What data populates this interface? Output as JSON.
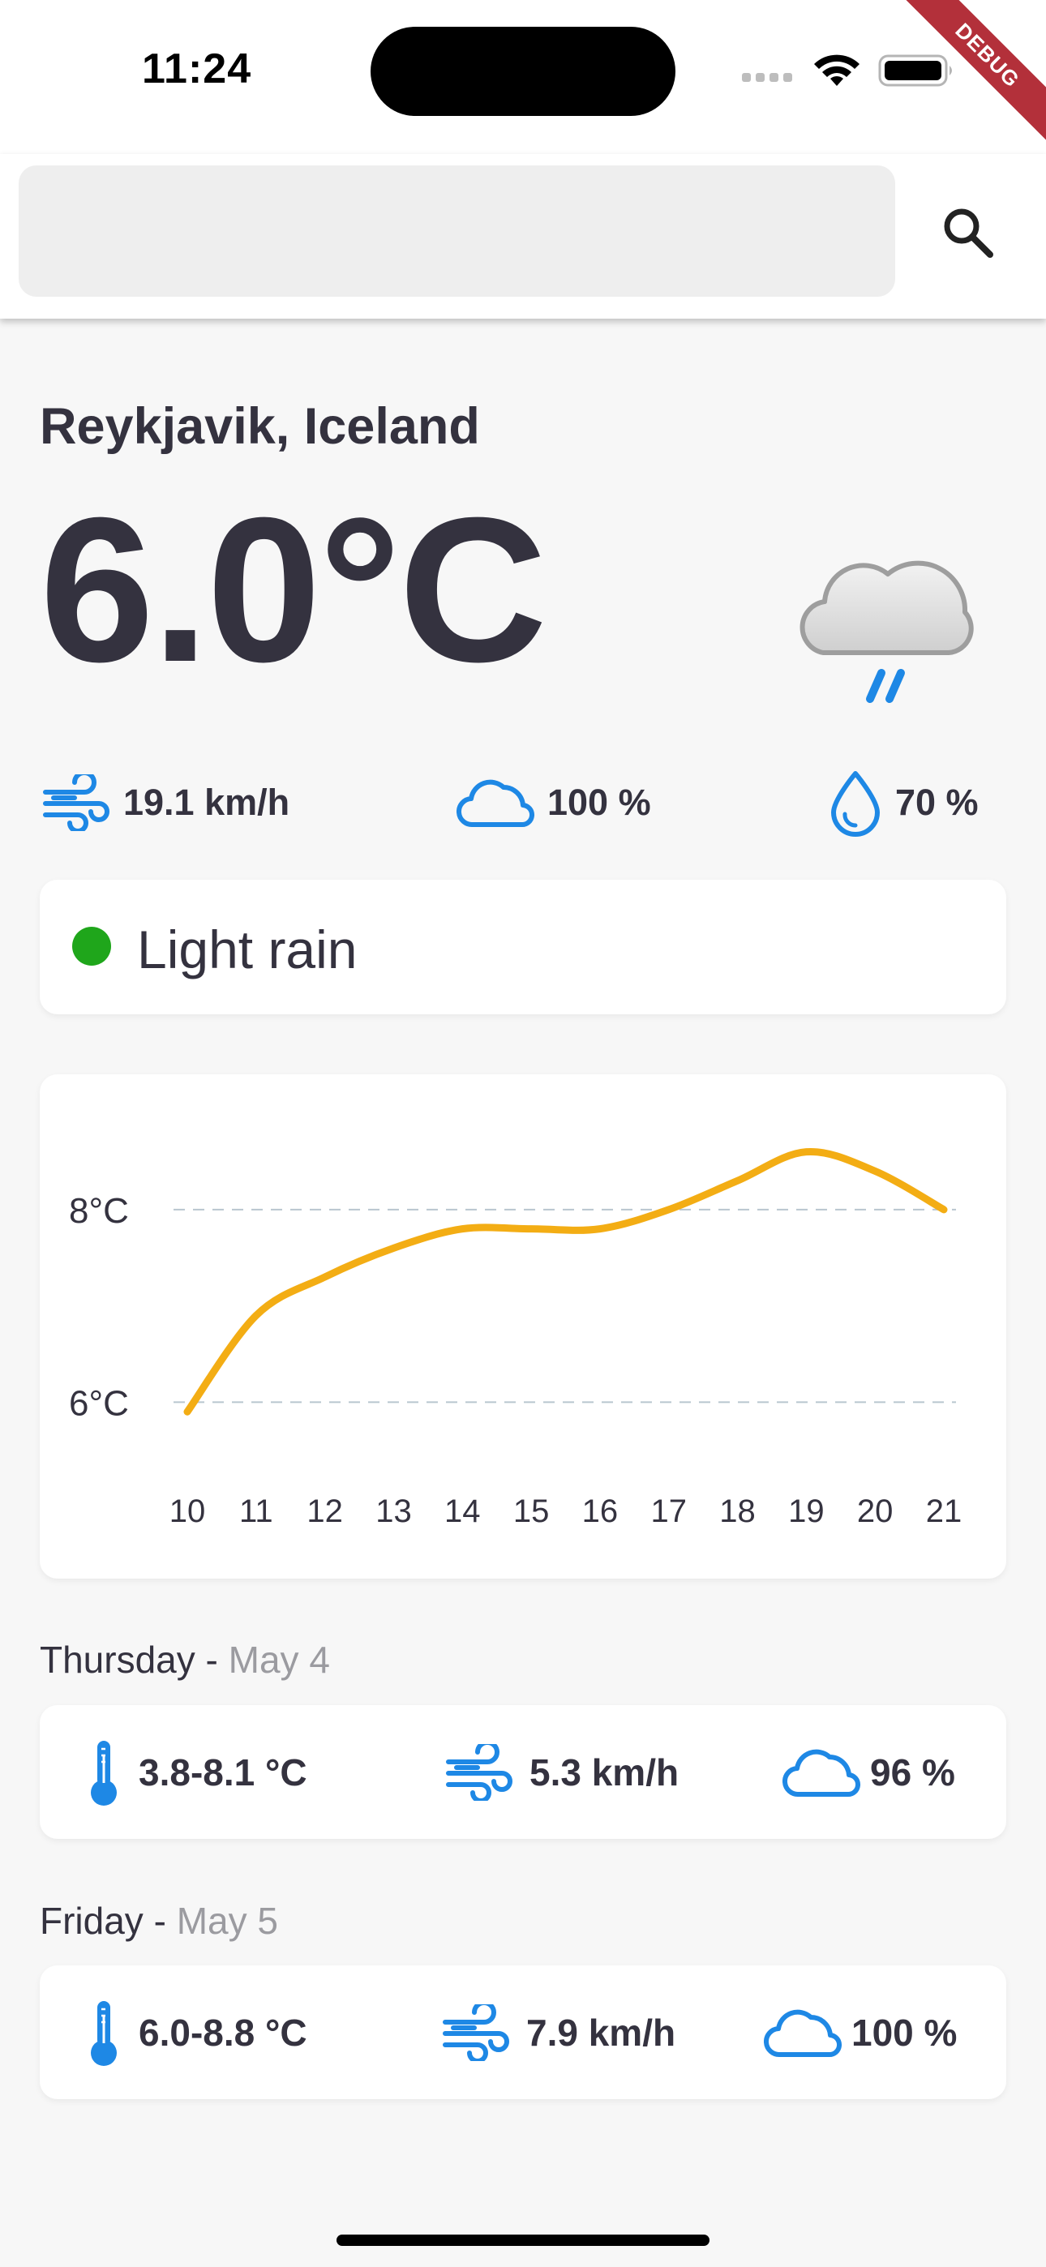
{
  "status_bar": {
    "time": "11:24",
    "debug_label": "DEBUG"
  },
  "search": {
    "placeholder": "",
    "value": ""
  },
  "current": {
    "location": "Reykjavik, Iceland",
    "temperature": "6.0°C",
    "wind": "19.1 km/h",
    "cloud": "100 %",
    "humidity": "70 %",
    "condition": "Light rain",
    "condition_color": "#1fa61b"
  },
  "chart_data": {
    "type": "line",
    "x": [
      "10",
      "11",
      "12",
      "13",
      "14",
      "15",
      "16",
      "17",
      "18",
      "19",
      "20",
      "21"
    ],
    "series": [
      {
        "values": [
          5.9,
          6.9,
          7.3,
          7.6,
          7.8,
          7.8,
          7.8,
          8.0,
          8.3,
          8.6,
          8.4,
          8.0
        ]
      }
    ],
    "y_ticks": [
      "6°C",
      "8°C"
    ],
    "ylim": [
      5.7,
      8.9
    ],
    "grid": "dashed horizontal at ticks",
    "line_color": "#f3ad14"
  },
  "forecast": [
    {
      "day": "Thursday",
      "separator": " - ",
      "date": "May 4",
      "temp_range": "3.8-8.1 °C",
      "wind": "5.3 km/h",
      "cloud": "96 %"
    },
    {
      "day": "Friday",
      "separator": " - ",
      "date": "May 5",
      "temp_range": "6.0-8.8 °C",
      "wind": "7.9 km/h",
      "cloud": "100 %"
    }
  ],
  "colors": {
    "icon_blue": "#1e88e5",
    "text": "#34323f",
    "muted": "#9b9ba0",
    "chart_line": "#f3ad14"
  }
}
